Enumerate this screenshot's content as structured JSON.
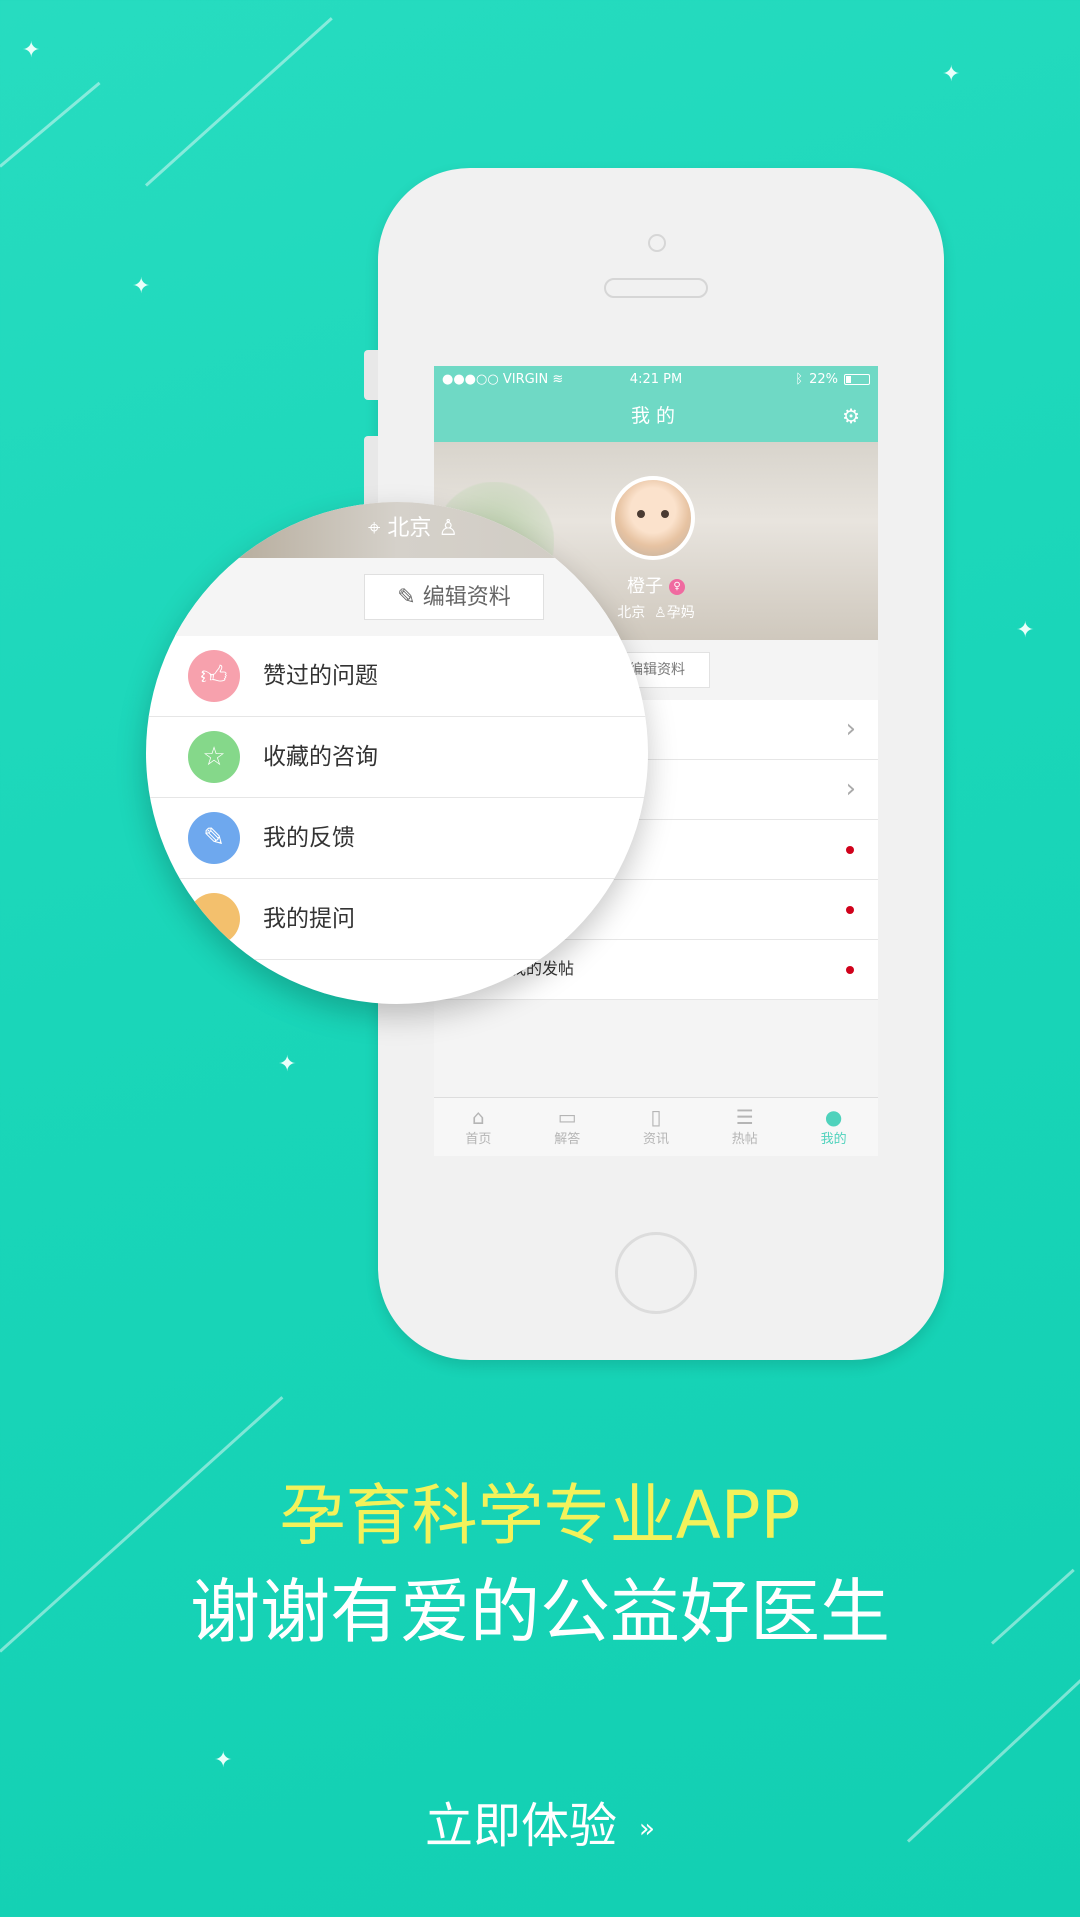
{
  "status_bar": {
    "carrier": "●●●○○ VIRGIN ≋",
    "time": "4:21 PM",
    "battery": "22%",
    "bluetooth_icon": "bluetooth-icon"
  },
  "app": {
    "title": "我的",
    "profile": {
      "name": "橙子",
      "location": "北京",
      "role": "孕妈"
    },
    "edit_label": "编辑资料",
    "menu": [
      {
        "label": "赞过的问题",
        "icon": "thumbs-up-icon",
        "color": "#f7a1ad",
        "indicator": "arrow"
      },
      {
        "label": "收藏的咨询",
        "icon": "star-icon",
        "color": "#85d88a",
        "indicator": "arrow"
      },
      {
        "label": "我的反馈",
        "icon": "pencil-icon",
        "color": "#6ea8ee",
        "indicator": "dot"
      },
      {
        "label": "我的提问",
        "icon": "question-icon",
        "color": "#f3c06d",
        "indicator": "dot"
      },
      {
        "label": "我的发帖",
        "icon": "post-icon",
        "color": "#8ad0f0",
        "indicator": "dot"
      }
    ],
    "tabs": [
      {
        "label": "首页",
        "icon": "home-icon"
      },
      {
        "label": "解答",
        "icon": "chat-icon"
      },
      {
        "label": "资讯",
        "icon": "book-icon"
      },
      {
        "label": "热帖",
        "icon": "document-icon"
      },
      {
        "label": "我的",
        "icon": "person-icon",
        "active": true
      }
    ]
  },
  "captions": {
    "line1": "孕育科学专业APP",
    "line2": "谢谢有爱的公益好医生"
  },
  "cta": {
    "label": "立即体验",
    "chevron": "»"
  },
  "colors": {
    "background": "#1ad6b9",
    "accent": "#6fd9c5",
    "headline": "#f3f25a",
    "notification_dot": "#d0021b"
  }
}
